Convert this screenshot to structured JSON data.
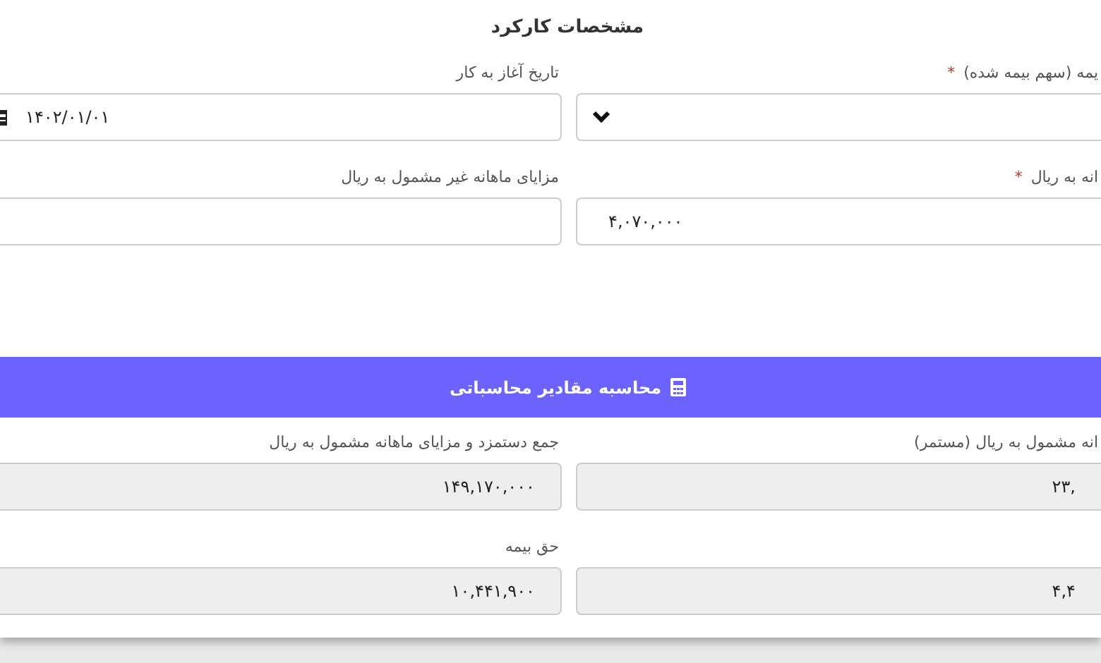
{
  "title": "مشخصات کارکرد",
  "fields": [
    {
      "kind": "select",
      "label": "یمه (سهم بیمه شده)",
      "required_mark": "*"
    },
    {
      "kind": "date",
      "label": "تاریخ آغاز به کار",
      "value": "۱۴۰۲/۰۱/۰۱"
    },
    {
      "kind": "text",
      "label": "انه به ریال",
      "required_mark": "*",
      "value": "۴,۰۷۰,۰۰۰"
    },
    {
      "kind": "text",
      "label": "مزایای ماهانه غیر مشمول به ریال"
    }
  ],
  "calc_button": {
    "label": "محاسبه مقادیر محاسباتی"
  },
  "results": [
    {
      "label": "انه مشمول به ریال (مستمر)",
      "value": "۲۳,",
      "disabled": true
    },
    {
      "label": "جمع دستمزد و مزایای ماهانه مشمول به ریال",
      "value": "۱۴۹,۱۷۰,۰۰۰",
      "disabled": true
    },
    {
      "value": "۴,۴",
      "disabled": true
    },
    {
      "label": "حق بیمه",
      "value": "۱۰,۴۴۱,۹۰۰",
      "disabled": true
    }
  ]
}
